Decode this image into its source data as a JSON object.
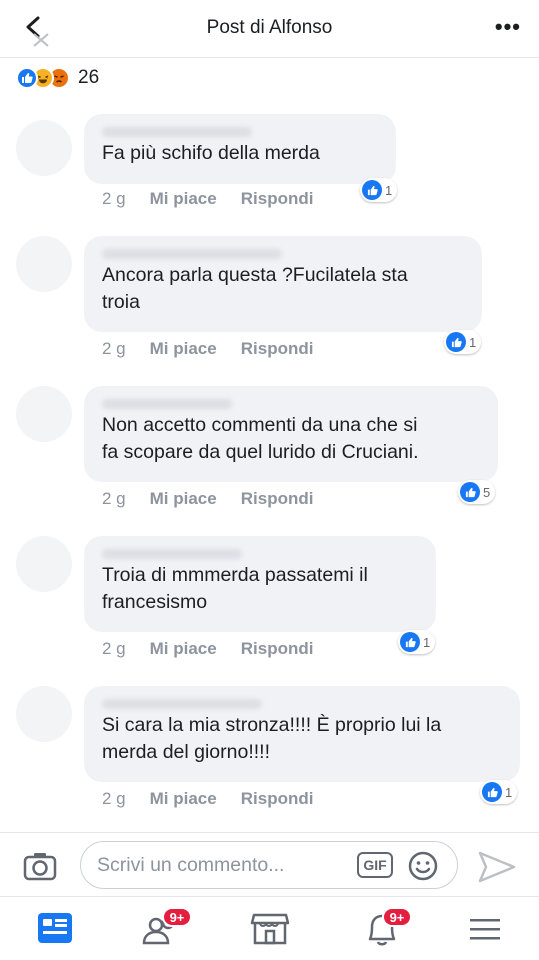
{
  "header": {
    "title": "Post di Alfonso",
    "more": "•••"
  },
  "reactions": {
    "count": "26",
    "types": [
      "like-icon",
      "haha-icon",
      "angry-icon"
    ]
  },
  "comments": [
    {
      "text": "Fa più schifo della merda",
      "time": "2 g",
      "like": "Mi piace",
      "reply": "Rispondi",
      "likes": "1"
    },
    {
      "text": "Ancora parla questa ?Fucilatela sta\ntroia",
      "time": "2 g",
      "like": "Mi piace",
      "reply": "Rispondi",
      "likes": "1"
    },
    {
      "text": "Non accetto commenti da una che si\nfa scopare da quel lurido di Cruciani.",
      "time": "2 g",
      "like": "Mi piace",
      "reply": "Rispondi",
      "likes": "5"
    },
    {
      "text": "Troia di mmmerda passatemi il\nfrancesismo",
      "time": "2 g",
      "like": "Mi piace",
      "reply": "Rispondi",
      "likes": "1"
    },
    {
      "text": "Si cara la mia stronza!!!! È proprio lui la\nmerda del giorno!!!!",
      "time": "2 g",
      "like": "Mi piace",
      "reply": "Rispondi",
      "likes": "1"
    }
  ],
  "composer": {
    "placeholder": "Scrivi un commento...",
    "gif": "GIF"
  },
  "nav": {
    "friends_badge": "9+",
    "notifications_badge": "9+"
  },
  "colors": {
    "accent": "#1877f2",
    "badge": "#e41e3f",
    "bubble": "#f0f2f5",
    "meta": "#8d949e"
  }
}
